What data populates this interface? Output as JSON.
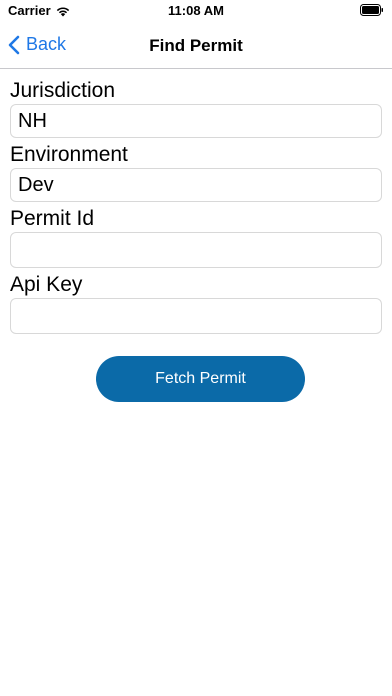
{
  "status": {
    "carrier": "Carrier",
    "time": "11:08 AM"
  },
  "nav": {
    "back_label": "Back",
    "title": "Find Permit"
  },
  "form": {
    "jurisdiction": {
      "label": "Jurisdiction",
      "value": "NH"
    },
    "environment": {
      "label": "Environment",
      "value": "Dev"
    },
    "permit_id": {
      "label": "Permit Id",
      "value": ""
    },
    "api_key": {
      "label": "Api Key",
      "value": ""
    }
  },
  "actions": {
    "fetch_label": "Fetch Permit"
  },
  "colors": {
    "accent": "#1f78e6",
    "button": "#0b6aa8"
  }
}
